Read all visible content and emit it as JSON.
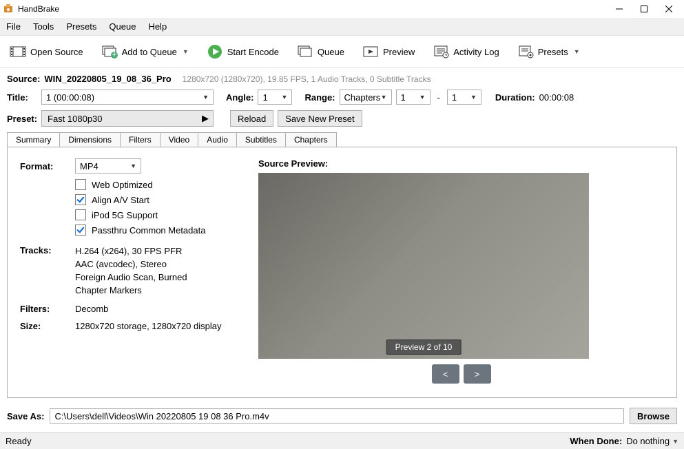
{
  "window": {
    "title": "HandBrake"
  },
  "menu": {
    "file": "File",
    "tools": "Tools",
    "presets": "Presets",
    "queue": "Queue",
    "help": "Help"
  },
  "toolbar": {
    "open_source": "Open Source",
    "add_queue": "Add to Queue",
    "start_encode": "Start Encode",
    "queue": "Queue",
    "preview": "Preview",
    "activity_log": "Activity Log",
    "presets": "Presets"
  },
  "source": {
    "label": "Source:",
    "name": "WIN_20220805_19_08_36_Pro",
    "details": "1280x720 (1280x720), 19.85 FPS, 1 Audio Tracks, 0 Subtitle Tracks"
  },
  "title_row": {
    "title_label": "Title:",
    "title_value": "1  (00:00:08)",
    "angle_label": "Angle:",
    "angle_value": "1",
    "range_label": "Range:",
    "range_type": "Chapters",
    "range_from": "1",
    "range_to": "1",
    "duration_label": "Duration:",
    "duration_value": "00:00:08"
  },
  "preset": {
    "label": "Preset:",
    "value": "Fast 1080p30",
    "reload": "Reload",
    "save_new": "Save New Preset"
  },
  "tabs": {
    "summary": "Summary",
    "dimensions": "Dimensions",
    "filters": "Filters",
    "video": "Video",
    "audio": "Audio",
    "subtitles": "Subtitles",
    "chapters": "Chapters"
  },
  "summary": {
    "format_label": "Format:",
    "format_value": "MP4",
    "web_opt": "Web Optimized",
    "align_av": "Align A/V Start",
    "ipod5g": "iPod 5G Support",
    "passthru": "Passthru Common Metadata",
    "tracks_label": "Tracks:",
    "track1": "H.264 (x264), 30 FPS PFR",
    "track2": "AAC (avcodec), Stereo",
    "track3": "Foreign Audio Scan, Burned",
    "track4": "Chapter Markers",
    "filters_label": "Filters:",
    "filters_value": "Decomb",
    "size_label": "Size:",
    "size_value": "1280x720 storage, 1280x720 display",
    "preview_label": "Source Preview:",
    "preview_badge": "Preview 2 of 10",
    "prev": "<",
    "next": ">"
  },
  "saveas": {
    "label": "Save As:",
    "path": "C:\\Users\\dell\\Videos\\Win 20220805 19 08 36 Pro.m4v",
    "browse": "Browse"
  },
  "status": {
    "ready": "Ready",
    "when_done_label": "When Done:",
    "when_done_value": "Do nothing"
  }
}
